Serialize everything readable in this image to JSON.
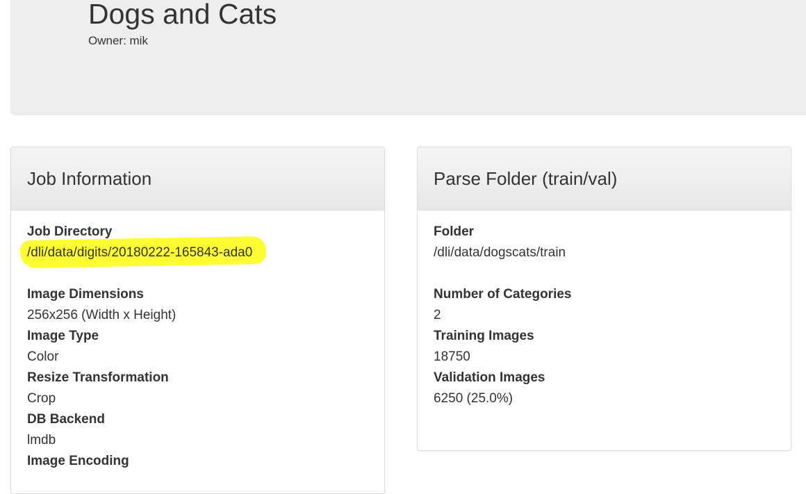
{
  "header": {
    "title": "Dogs and Cats",
    "owner": "Owner: mik"
  },
  "job_panel": {
    "title": "Job Information",
    "fields": [
      {
        "label": "Job Directory",
        "value": "/dli/data/digits/20180222-165843-ada0"
      },
      {
        "label": "Image Dimensions",
        "value": "256x256 (Width x Height)"
      },
      {
        "label": "Image Type",
        "value": "Color"
      },
      {
        "label": "Resize Transformation",
        "value": "Crop"
      },
      {
        "label": "DB Backend",
        "value": "lmdb"
      },
      {
        "label": "Image Encoding",
        "value": ""
      }
    ]
  },
  "parse_panel": {
    "title": "Parse Folder (train/val)",
    "fields": [
      {
        "label": "Folder",
        "value": "/dli/data/dogscats/train"
      },
      {
        "label": "Number of Categories",
        "value": "2"
      },
      {
        "label": "Training Images",
        "value": "18750"
      },
      {
        "label": "Validation Images",
        "value": "6250 (25.0%)"
      }
    ]
  },
  "colors": {
    "highlight": "#ffff33",
    "header_bg": "#eeeeee",
    "text": "#333333"
  }
}
